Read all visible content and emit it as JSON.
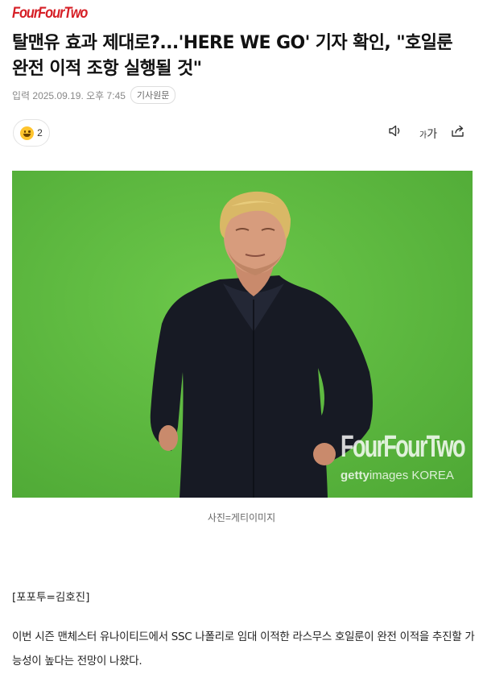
{
  "header": {
    "logo_text": "FourFourTwo",
    "brand_color": "#d61f26"
  },
  "article": {
    "headline": "탈맨유 효과 제대로?...'HERE WE GO' 기자 확인, \"호일룬 완전 이적 조항 실행될 것\"",
    "published": "입력 2025.09.19. 오후 7:45",
    "source_label": "기사원문",
    "reaction_count": "2",
    "reaction_icon": "grinning-emoji-icon",
    "tools": {
      "audio_icon": "speaker-icon",
      "font_small": "가",
      "font_big": "가",
      "share_icon": "share-icon"
    },
    "photo": {
      "watermark_brand": "FourFourTwo",
      "watermark_getty_bold": "getty",
      "watermark_getty_rest": "images KOREA"
    },
    "caption": "사진=게티이미지",
    "byline": "[포포투=김호진]",
    "body": "이번 시즌 맨체스터 유나이티드에서 SSC 나폴리로 임대 이적한 라스무스 호일룬이 완전 이적을 추진할 가능성이 높다는 전망이 나왔다."
  }
}
